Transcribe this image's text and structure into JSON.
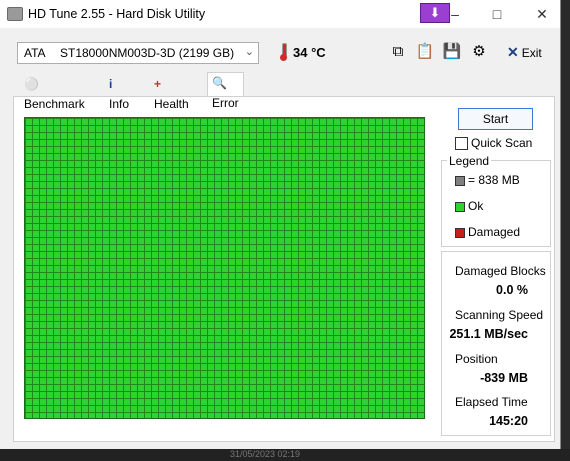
{
  "window": {
    "title": "HD Tune 2.55 - Hard Disk Utility",
    "overlay_glyph": "⬇"
  },
  "toolbar": {
    "drive_type": "ATA",
    "drive_model": "ST18000NM003D-3D (2199 GB)",
    "temperature": "34 °C",
    "exit_label": "Exit"
  },
  "tabs": [
    {
      "label": "Benchmark",
      "icon": "lightbulb-icon"
    },
    {
      "label": "Info",
      "icon": "info-icon"
    },
    {
      "label": "Health",
      "icon": "health-cross-icon"
    },
    {
      "label": "Error Scan",
      "icon": "magnifier-icon",
      "active": true
    }
  ],
  "scan": {
    "start_label": "Start",
    "quick_scan_label": "Quick Scan",
    "quick_scan_checked": false,
    "block_state": "Ok"
  },
  "legend": {
    "title": "Legend",
    "block_size": "= 838 MB",
    "ok_label": "Ok",
    "damaged_label": "Damaged",
    "colors": {
      "block": "#808080",
      "ok": "#2fd32f",
      "damaged": "#c81e1e"
    }
  },
  "stats": {
    "damaged_blocks_label": "Damaged Blocks",
    "damaged_blocks_value": "0.0 %",
    "scanning_speed_label": "Scanning Speed",
    "scanning_speed_value": "251.1 MB/sec",
    "position_label": "Position",
    "position_value": "-839 MB",
    "elapsed_label": "Elapsed Time",
    "elapsed_value": "145:20"
  },
  "taskbar": {
    "clock_fragment": "31/05/2023 02:19"
  }
}
